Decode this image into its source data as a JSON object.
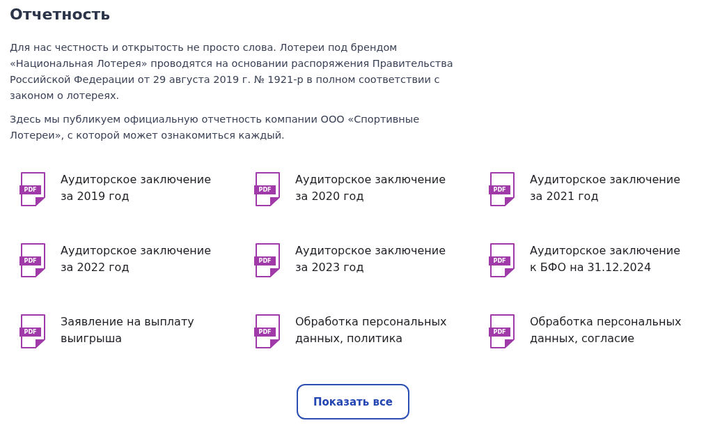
{
  "title": "Отчетность",
  "intro": [
    {
      "lines": [
        "Для нас честность и открытость не просто слова. Лотереи под брендом",
        "«Национальная Лотерея» проводятся на основании распоряжения Правительства",
        "Российской Федерации от 29 августа 2019 г. № 1921-р в полном соответствии с",
        "законом о лотереях."
      ]
    },
    {
      "lines": [
        "Здесь мы публикуем официальную отчетность компании ООО «Спортивные",
        "Лотереи», с которой может ознакомиться каждый."
      ]
    }
  ],
  "documents": [
    {
      "file_type": "PDF",
      "lines": [
        "Аудиторское заключение",
        "за 2019 год"
      ]
    },
    {
      "file_type": "PDF",
      "lines": [
        "Аудиторское заключение",
        "за 2020 год"
      ]
    },
    {
      "file_type": "PDF",
      "lines": [
        "Аудиторское заключение",
        "за 2021 год"
      ]
    },
    {
      "file_type": "PDF",
      "lines": [
        "Аудиторское заключение",
        "за 2022 год"
      ]
    },
    {
      "file_type": "PDF",
      "lines": [
        "Аудиторское заключение",
        "за 2023 год"
      ]
    },
    {
      "file_type": "PDF",
      "lines": [
        "Аудиторское заключение",
        "к БФО на 31.12.2024"
      ]
    },
    {
      "file_type": "PDF",
      "lines": [
        "Заявление на выплату",
        "выигрыша"
      ]
    },
    {
      "file_type": "PDF",
      "lines": [
        "Обработка персональных",
        "данных, политика"
      ]
    },
    {
      "file_type": "PDF",
      "lines": [
        "Обработка персональных",
        "данных, согласие"
      ]
    }
  ],
  "show_all_button": "Показать все"
}
